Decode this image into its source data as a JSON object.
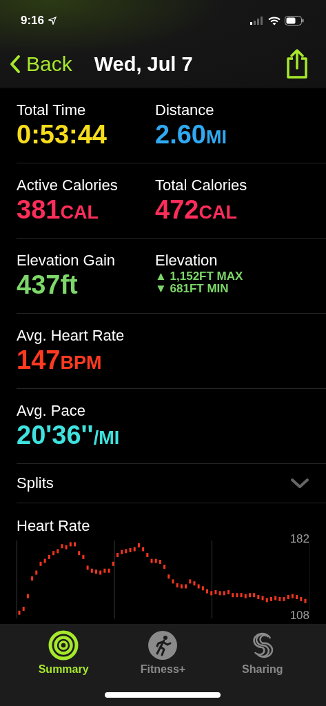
{
  "status_bar": {
    "time": "9:16"
  },
  "nav": {
    "back": "Back",
    "title": "Wed, Jul 7"
  },
  "metric_rows": [
    {
      "cells": [
        {
          "kind": "value",
          "label": "Total Time",
          "value": "0:53:44",
          "color": "#f6dc1c"
        },
        {
          "kind": "value",
          "label": "Distance",
          "value": "2.60",
          "unit": "MI",
          "color": "#2fa9f2"
        }
      ]
    },
    {
      "cells": [
        {
          "kind": "value",
          "label": "Active Calories",
          "value": "381",
          "unit": "CAL",
          "color": "#fd2d5a"
        },
        {
          "kind": "value",
          "label": "Total Calories",
          "value": "472",
          "unit": "CAL",
          "color": "#fd2d5a"
        }
      ]
    },
    {
      "cells": [
        {
          "kind": "value",
          "label": "Elevation Gain",
          "value": "437ft",
          "color": "#7dd76a"
        },
        {
          "kind": "range",
          "label": "Elevation",
          "max": "▲ 1,152FT MAX",
          "min": "▼ 681FT MIN",
          "color": "#7dd76a"
        }
      ]
    },
    {
      "cells": [
        {
          "kind": "value",
          "label": "Avg. Heart Rate",
          "value": "147",
          "unit": "BPM",
          "color": "#ff3a20"
        }
      ]
    },
    {
      "cells": [
        {
          "kind": "value",
          "label": "Avg. Pace",
          "value": "20'36''",
          "unit": "/MI",
          "color": "#3fe2de"
        }
      ]
    }
  ],
  "splits": {
    "label": "Splits",
    "expanded": false
  },
  "heart_rate": {
    "title": "Heart Rate",
    "max_label": "182",
    "min_label": "108"
  },
  "tabs": [
    {
      "label": "Summary",
      "selected": true
    },
    {
      "label": "Fitness+",
      "selected": false
    },
    {
      "label": "Sharing",
      "selected": false
    }
  ]
}
